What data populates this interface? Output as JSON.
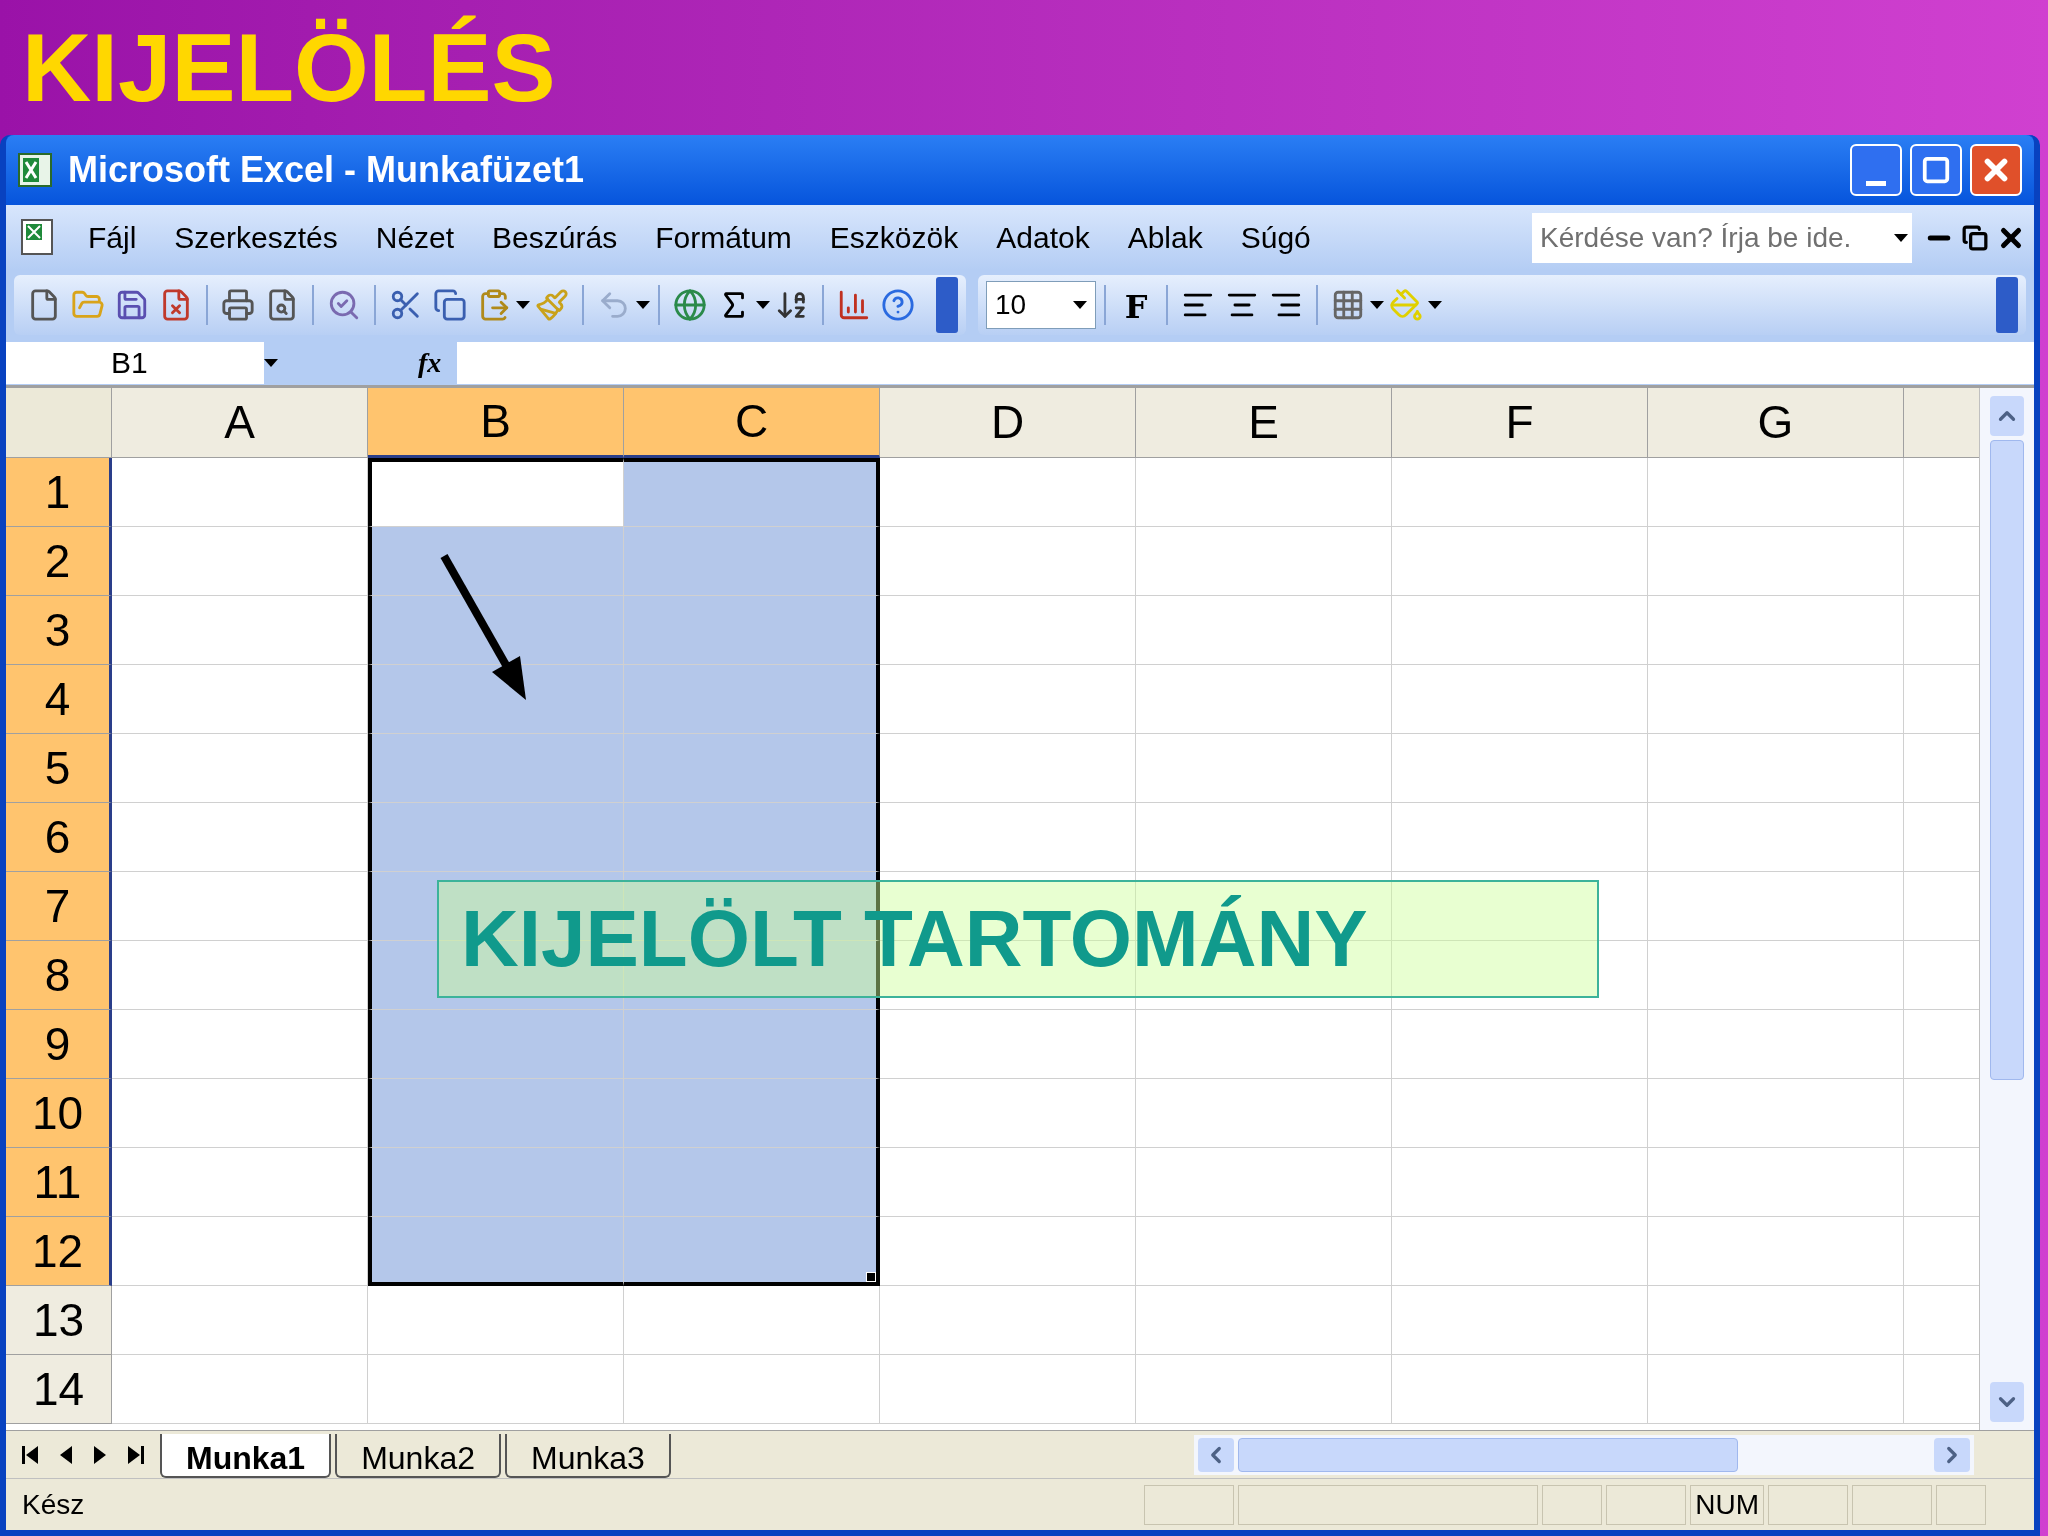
{
  "slide_title": "KIJELÖLÉS",
  "window": {
    "title": "Microsoft Excel - Munkafüzet1"
  },
  "menu": [
    "Fájl",
    "Szerkesztés",
    "Nézet",
    "Beszúrás",
    "Formátum",
    "Eszközök",
    "Adatok",
    "Ablak",
    "Súgó"
  ],
  "help_search": {
    "placeholder": "Kérdése van? Írja be ide."
  },
  "font_size": {
    "value": "10"
  },
  "bold_button": "F",
  "name_box": {
    "value": "B1"
  },
  "formula_label": "fx",
  "columns": [
    {
      "label": "A",
      "selected": false
    },
    {
      "label": "B",
      "selected": true
    },
    {
      "label": "C",
      "selected": true
    },
    {
      "label": "D",
      "selected": false
    },
    {
      "label": "E",
      "selected": false
    },
    {
      "label": "F",
      "selected": false
    },
    {
      "label": "G",
      "selected": false
    }
  ],
  "rows": [
    {
      "label": "1",
      "selected": true
    },
    {
      "label": "2",
      "selected": true
    },
    {
      "label": "3",
      "selected": true
    },
    {
      "label": "4",
      "selected": true
    },
    {
      "label": "5",
      "selected": true
    },
    {
      "label": "6",
      "selected": true
    },
    {
      "label": "7",
      "selected": true
    },
    {
      "label": "8",
      "selected": true
    },
    {
      "label": "9",
      "selected": true
    },
    {
      "label": "10",
      "selected": true
    },
    {
      "label": "11",
      "selected": true
    },
    {
      "label": "12",
      "selected": true
    },
    {
      "label": "13",
      "selected": false
    },
    {
      "label": "14",
      "selected": false
    }
  ],
  "callout": "KIJELÖLT TARTOMÁNY",
  "sheet_tabs": [
    {
      "label": "Munka1",
      "selected": true
    },
    {
      "label": "Munka2",
      "selected": false
    },
    {
      "label": "Munka3",
      "selected": false
    }
  ],
  "status": {
    "text": "Kész",
    "indicators": [
      "NUM"
    ]
  }
}
